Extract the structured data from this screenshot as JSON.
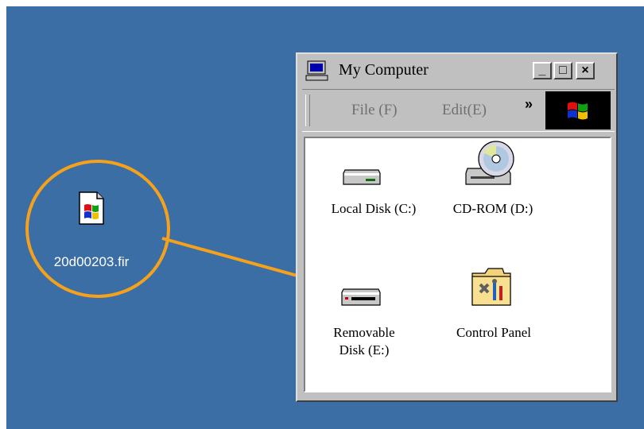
{
  "desktop": {
    "file": {
      "label": "20d00203.fir",
      "icon": "windows-flag-file-icon"
    }
  },
  "window": {
    "title": "My Computer",
    "title_icon": "computer-icon",
    "buttons": {
      "minimize": "_",
      "maximize": "□",
      "close": "×"
    },
    "menu": [
      {
        "label": "File (F)"
      },
      {
        "label": "Edit(E)"
      }
    ],
    "chevron": "»",
    "brand_icon": "windows-logo-icon",
    "items": [
      {
        "label": "Local Disk (C:)",
        "icon": "hard-disk-icon"
      },
      {
        "label": "CD-ROM (D:)",
        "icon": "cd-rom-icon"
      },
      {
        "label": "Removable Disk (E:)",
        "label_line1": "Removable",
        "label_line2": "Disk (E:)",
        "icon": "removable-disk-icon"
      },
      {
        "label": "Control Panel",
        "icon": "control-panel-icon"
      }
    ]
  },
  "colors": {
    "desktop": "#3a6ea5",
    "highlight": "#f6a11c",
    "window": "#c0c0c0"
  }
}
